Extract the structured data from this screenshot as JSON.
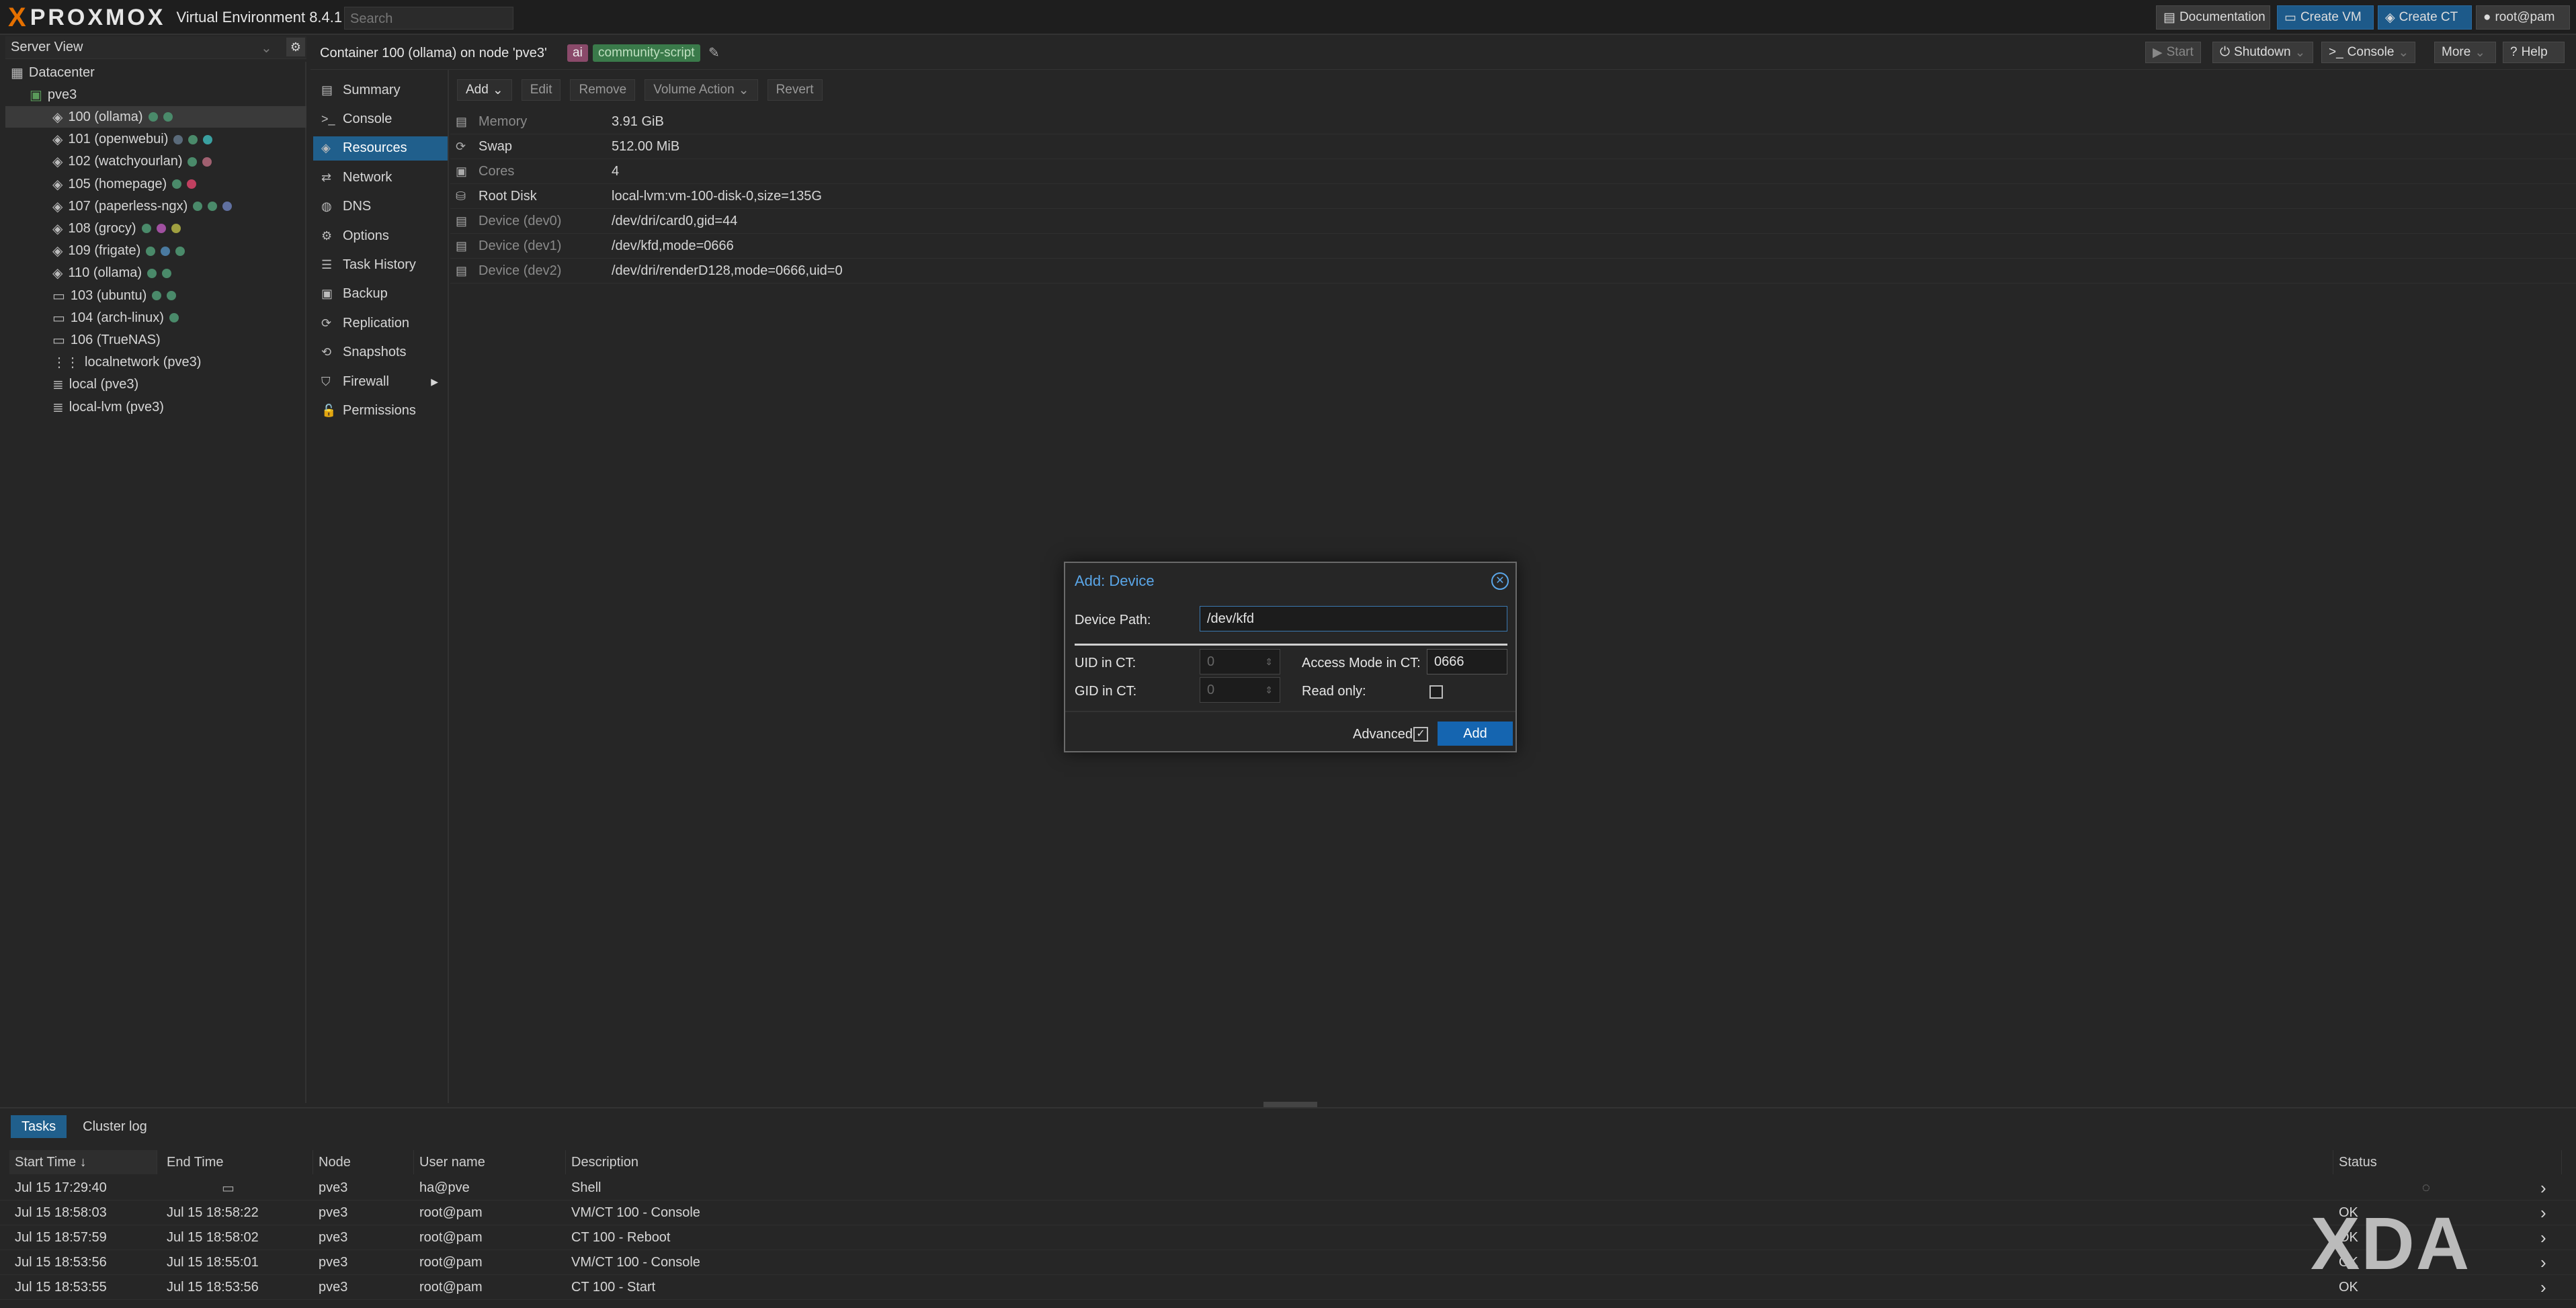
{
  "topbar": {
    "logo_x": "X",
    "logo_word": "PROXMOX",
    "version": "Virtual Environment 8.4.1",
    "search_placeholder": "Search",
    "documentation": "Documentation",
    "create_vm": "Create VM",
    "create_ct": "Create CT",
    "user": "root@pam"
  },
  "left": {
    "view": "Server View",
    "tree": [
      {
        "label": "Datacenter",
        "icon": "datacenter-icon"
      },
      {
        "label": "pve3",
        "icon": "node-icon"
      },
      {
        "label": "100 (ollama)",
        "icon": "container-icon",
        "dots": [
          "#4a8a6a",
          "#4a8a6a"
        ]
      },
      {
        "label": "101 (openwebui)",
        "icon": "container-icon",
        "dots": [
          "#5a6a7a",
          "#4a8a6a",
          "#3aa0a0"
        ]
      },
      {
        "label": "102 (watchyourlan)",
        "icon": "container-icon",
        "dots": [
          "#4a8a6a",
          "#a06070"
        ]
      },
      {
        "label": "105 (homepage)",
        "icon": "container-icon",
        "dots": [
          "#4a8a6a",
          "#c04060"
        ]
      },
      {
        "label": "107 (paperless-ngx)",
        "icon": "container-icon",
        "dots": [
          "#4a8a6a",
          "#4a8a6a",
          "#6070a0"
        ]
      },
      {
        "label": "108 (grocy)",
        "icon": "container-icon",
        "dots": [
          "#4a8a6a",
          "#a050a0",
          "#a0a040"
        ]
      },
      {
        "label": "109 (frigate)",
        "icon": "container-icon",
        "dots": [
          "#4a8a6a",
          "#4a7aa0",
          "#4a8a6a"
        ]
      },
      {
        "label": "110 (ollama)",
        "icon": "container-icon",
        "dots": [
          "#4a8a6a",
          "#4a8a6a"
        ]
      },
      {
        "label": "103 (ubuntu)",
        "icon": "vm-icon",
        "dots": [
          "#4a8a6a",
          "#4a8a6a"
        ]
      },
      {
        "label": "104 (arch-linux)",
        "icon": "vm-icon",
        "dots": [
          "#4a8a6a"
        ]
      },
      {
        "label": "106 (TrueNAS)",
        "icon": "vm-icon",
        "dots": []
      },
      {
        "label": "localnetwork (pve3)",
        "icon": "network-icon",
        "dots": []
      },
      {
        "label": "local (pve3)",
        "icon": "storage-icon",
        "dots": []
      },
      {
        "label": "local-lvm (pve3)",
        "icon": "storage-icon",
        "dots": []
      }
    ]
  },
  "content": {
    "title": "Container 100 (ollama) on node 'pve3'",
    "tag_ai": "ai",
    "tag_community": "community-script",
    "start": "Start",
    "shutdown": "Shutdown",
    "console": "Console",
    "more": "More",
    "help": "Help"
  },
  "subnav": [
    {
      "label": "Summary",
      "icon": "summary-icon"
    },
    {
      "label": "Console",
      "icon": "console-icon"
    },
    {
      "label": "Resources",
      "icon": "resources-icon",
      "selected": true
    },
    {
      "label": "Network",
      "icon": "network-icon"
    },
    {
      "label": "DNS",
      "icon": "dns-icon"
    },
    {
      "label": "Options",
      "icon": "gear-icon"
    },
    {
      "label": "Task History",
      "icon": "list-icon"
    },
    {
      "label": "Backup",
      "icon": "backup-icon"
    },
    {
      "label": "Replication",
      "icon": "replication-icon"
    },
    {
      "label": "Snapshots",
      "icon": "snapshot-icon"
    },
    {
      "label": "Firewall",
      "icon": "shield-icon"
    },
    {
      "label": "Permissions",
      "icon": "unlock-icon"
    }
  ],
  "resources": {
    "toolbar": {
      "add": "Add",
      "edit": "Edit",
      "remove": "Remove",
      "volume_action": "Volume Action",
      "revert": "Revert"
    },
    "rows": [
      {
        "key": "Memory",
        "value": "3.91 GiB",
        "dim": true
      },
      {
        "key": "Swap",
        "value": "512.00 MiB",
        "dim": false
      },
      {
        "key": "Cores",
        "value": "4",
        "dim": true
      },
      {
        "key": "Root Disk",
        "value": "local-lvm:vm-100-disk-0,size=135G",
        "dim": false
      },
      {
        "key": "Device (dev0)",
        "value": "/dev/dri/card0,gid=44",
        "dim": true
      },
      {
        "key": "Device (dev1)",
        "value": "/dev/kfd,mode=0666",
        "dim": true
      },
      {
        "key": "Device (dev2)",
        "value": "/dev/dri/renderD128,mode=0666,uid=0",
        "dim": true
      }
    ]
  },
  "modal": {
    "title": "Add: Device",
    "device_path_label": "Device Path:",
    "device_path_value": "/dev/kfd",
    "uid_label": "UID in CT:",
    "uid_value": "0",
    "gid_label": "GID in CT:",
    "gid_value": "0",
    "access_label": "Access Mode in CT:",
    "access_value": "0666",
    "readonly_label": "Read only:",
    "advanced_label": "Advanced",
    "add_button": "Add"
  },
  "bottom": {
    "tabs": [
      "Tasks",
      "Cluster log"
    ],
    "columns": [
      "Start Time ↓",
      "End Time",
      "Node",
      "User name",
      "Description",
      "Status"
    ],
    "rows": [
      {
        "start": "Jul 15 17:29:40",
        "end": "",
        "node": "pve3",
        "user": "ha@pve",
        "desc": "Shell",
        "status": ""
      },
      {
        "start": "Jul 15 18:58:03",
        "end": "Jul 15 18:58:22",
        "node": "pve3",
        "user": "root@pam",
        "desc": "VM/CT 100 - Console",
        "status": "OK"
      },
      {
        "start": "Jul 15 18:57:59",
        "end": "Jul 15 18:58:02",
        "node": "pve3",
        "user": "root@pam",
        "desc": "CT 100 - Reboot",
        "status": "OK"
      },
      {
        "start": "Jul 15 18:53:56",
        "end": "Jul 15 18:55:01",
        "node": "pve3",
        "user": "root@pam",
        "desc": "VM/CT 100 - Console",
        "status": "OK"
      },
      {
        "start": "Jul 15 18:53:55",
        "end": "Jul 15 18:53:56",
        "node": "pve3",
        "user": "root@pam",
        "desc": "CT 100 - Start",
        "status": "OK"
      }
    ]
  },
  "watermark": "XDA",
  "colors": {
    "accent": "#205f8c",
    "logo_orange": "#e57000",
    "modal_title": "#5aa6e8",
    "tag_ai": "#8a4a6a",
    "tag_community": "#3a7a4a"
  }
}
